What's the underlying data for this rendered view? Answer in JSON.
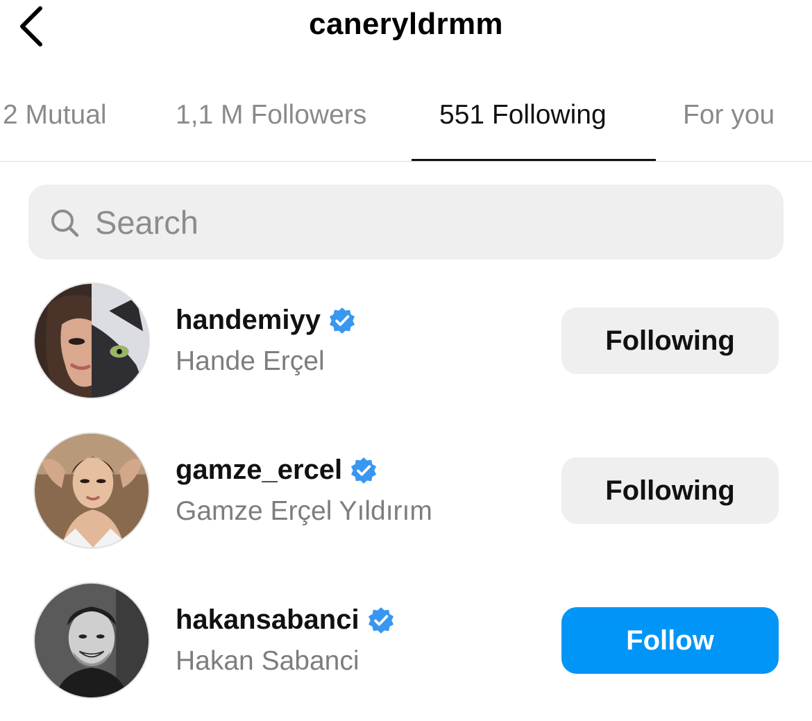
{
  "header": {
    "title": "caneryldrmm"
  },
  "tabs": [
    {
      "label": "2 Mutual"
    },
    {
      "label": "1,1 M Followers"
    },
    {
      "label": "551 Following"
    },
    {
      "label": "For you"
    }
  ],
  "search": {
    "placeholder": "Search",
    "value": ""
  },
  "users": [
    {
      "username": "handemiyy",
      "full_name": "Hande Erçel",
      "verified": true,
      "button": "Following"
    },
    {
      "username": "gamze_ercel",
      "full_name": "Gamze Erçel Yıldırım",
      "verified": true,
      "button": "Following"
    },
    {
      "username": "hakansabanci",
      "full_name": "Hakan Sabanci",
      "verified": true,
      "button": "Follow"
    }
  ],
  "colors": {
    "follow_blue": "#0095f6",
    "verified_blue": "#3897f0",
    "button_gray": "#efefef",
    "secondary_text": "#7d7d7d"
  },
  "icons": {
    "back": "chevron-left-icon",
    "search": "search-icon",
    "verified": "verified-badge-icon"
  }
}
